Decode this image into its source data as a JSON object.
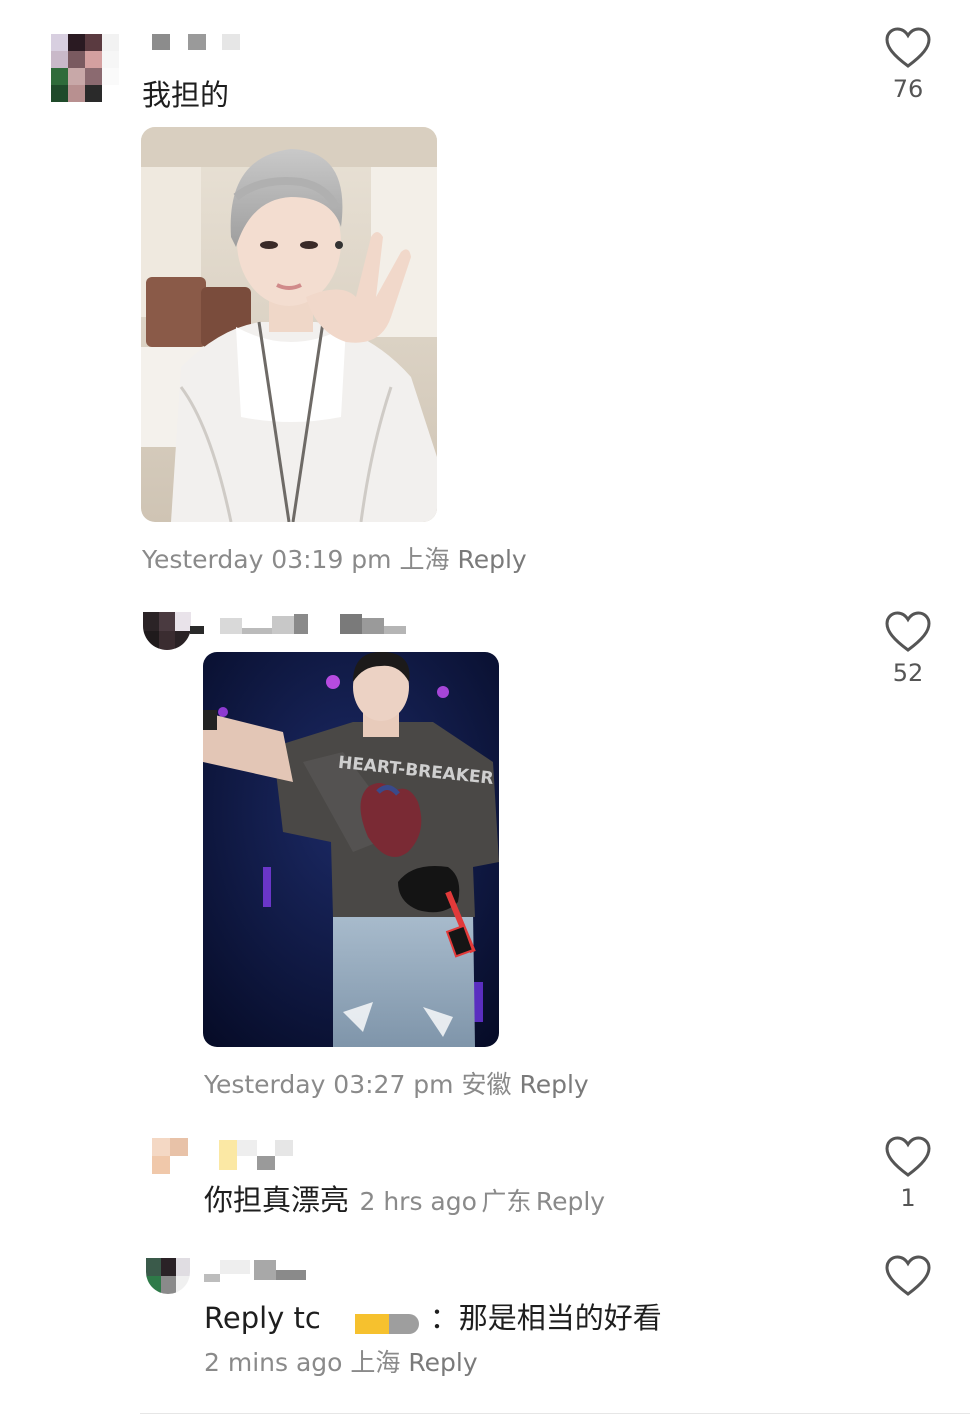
{
  "comments": [
    {
      "text": "我担的",
      "meta_time": "Yesterday 03:19 pm",
      "meta_loc": "上海",
      "meta_reply": "Reply",
      "likes": "76",
      "image": "photo-selfie-grey-hair-white-lace-top"
    },
    {
      "meta_time": "Yesterday 03:27 pm",
      "meta_loc": "安徽",
      "meta_reply": "Reply",
      "likes": "52",
      "image": "photo-stage-heart-breaker-shirt",
      "shirt_text": "HEART-BREAKER"
    },
    {
      "text": "你担真漂亮",
      "meta_time": "2 hrs ago",
      "meta_loc": "广东",
      "meta_reply": "Reply",
      "likes": "1"
    },
    {
      "reply_prefix": "Reply tc",
      "text": "：那是相当的好看",
      "meta_time": "2 mins ago",
      "meta_loc": "上海",
      "meta_reply": "Reply",
      "likes": ""
    }
  ],
  "colors": {
    "meta_gray": "#8a8a8a",
    "heart_gray": "#555555",
    "text": "#1e1e1e"
  }
}
